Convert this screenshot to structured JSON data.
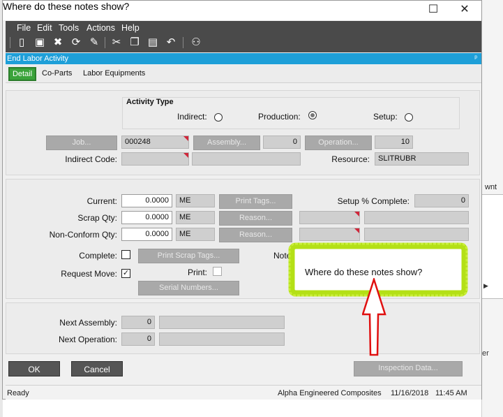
{
  "window": {
    "title": "Where do these notes show?",
    "minimize_glyph": "☐",
    "close_glyph": "✕"
  },
  "menu": {
    "items": [
      "File",
      "Edit",
      "Tools",
      "Actions",
      "Help"
    ]
  },
  "toolbar": {
    "icons": [
      "new-icon",
      "save-icon",
      "delete-icon",
      "refresh-icon",
      "clear-icon",
      "cut-icon",
      "copy-icon",
      "paste-icon",
      "undo-icon",
      "binoculars-icon"
    ]
  },
  "panel": {
    "title": "End Labor Activity",
    "pin_glyph": "📌"
  },
  "tabs": {
    "detail": "Detail",
    "coparts": "Co-Parts",
    "equipment": "Labor Equipments"
  },
  "activity": {
    "title": "Activity Type",
    "indirect": "Indirect:",
    "production": "Production:",
    "setup": "Setup:",
    "selected": "production"
  },
  "job": {
    "job_button": "Job...",
    "job_value": "000248",
    "assembly_button": "Assembly...",
    "assembly_value": "0",
    "operation_button": "Operation...",
    "operation_value": "10",
    "indirect_code_label": "Indirect Code:",
    "resource_label": "Resource:",
    "resource_value": "SLITRUBR"
  },
  "qty": {
    "current_label": "Current:",
    "current_value": "0.0000",
    "current_uom": "ME",
    "print_tags": "Print Tags...",
    "setup_pct_label": "Setup % Complete:",
    "setup_pct_value": "0",
    "scrap_label": "Scrap Qty:",
    "scrap_value": "0.0000",
    "scrap_uom": "ME",
    "reason1": "Reason...",
    "nonconform_label": "Non-Conform Qty:",
    "nonconform_value": "0.0000",
    "nonconform_uom": "ME",
    "reason2": "Reason...",
    "complete_label": "Complete:",
    "print_scrap_tags": "Print Scrap Tags...",
    "notes_label": "Note",
    "request_move_label": "Request Move:",
    "print_label": "Print:",
    "serial_numbers": "Serial Numbers..."
  },
  "next": {
    "assembly_label": "Next Assembly:",
    "assembly_value": "0",
    "operation_label": "Next Operation:",
    "operation_value": "0"
  },
  "buttons": {
    "ok": "OK",
    "cancel": "Cancel",
    "inspection": "Inspection Data..."
  },
  "status": {
    "left": "Ready",
    "company": "Alpha Engineered Composites",
    "date": "11/16/2018",
    "time": "11:45 AM"
  },
  "annotation": {
    "text": "Where do these notes show?",
    "highlight_color": "#b4e016",
    "arrow_color": "#e01010"
  },
  "background_app": {
    "tab_fragment": "wnt",
    "text_fragment": "er"
  }
}
